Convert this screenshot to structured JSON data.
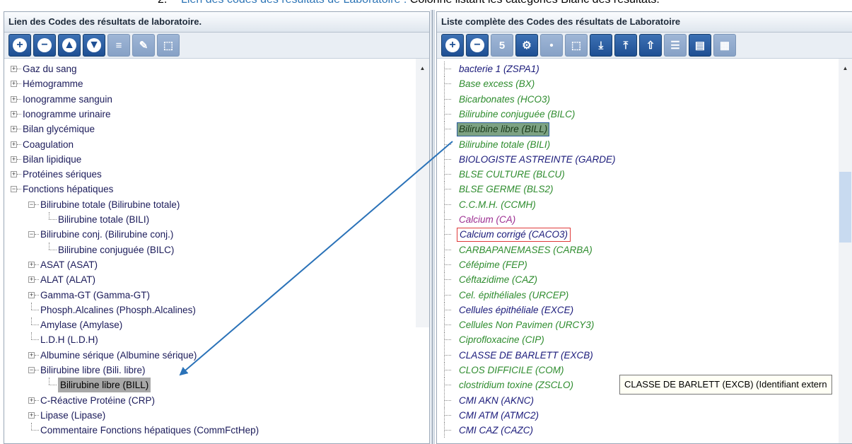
{
  "doc": {
    "number": "2.",
    "link_text": "Lien des codes des résultats de Laboratoire :",
    "rest_text": " Colonne listant les catégories Blanc des résultats."
  },
  "left_panel": {
    "title": "Lien des Codes des résultats de laboratoire.",
    "toolbar": [
      {
        "name": "add",
        "glyph": "+"
      },
      {
        "name": "remove",
        "glyph": "−"
      },
      {
        "name": "move-up",
        "glyph": "▲"
      },
      {
        "name": "move-down",
        "glyph": "▼"
      },
      {
        "name": "sort",
        "glyph": "≡"
      },
      {
        "name": "edit",
        "glyph": "✎"
      },
      {
        "name": "select-all",
        "glyph": "⬚"
      }
    ],
    "tree": [
      {
        "label": "Gaz du sang",
        "level": 0,
        "expander": "+"
      },
      {
        "label": "Hémogramme",
        "level": 0,
        "expander": "+"
      },
      {
        "label": "Ionogramme sanguin",
        "level": 0,
        "expander": "+"
      },
      {
        "label": "Ionogramme urinaire",
        "level": 0,
        "expander": "+"
      },
      {
        "label": "Bilan glycémique",
        "level": 0,
        "expander": "+"
      },
      {
        "label": "Coagulation",
        "level": 0,
        "expander": "+"
      },
      {
        "label": "Bilan lipidique",
        "level": 0,
        "expander": "+"
      },
      {
        "label": "Protéines sériques",
        "level": 0,
        "expander": "+"
      },
      {
        "label": "Fonctions hépatiques",
        "level": 0,
        "expander": "−"
      },
      {
        "label": "Bilirubine totale (Bilirubine totale)",
        "level": 1,
        "expander": "−"
      },
      {
        "label": "Bilirubine totale (BILI)",
        "level": 2,
        "expander": ""
      },
      {
        "label": "Bilirubine conj. (Bilirubine conj.)",
        "level": 1,
        "expander": "−"
      },
      {
        "label": "Bilirubine conjuguée (BILC)",
        "level": 2,
        "expander": ""
      },
      {
        "label": "ASAT (ASAT)",
        "level": 1,
        "expander": "+"
      },
      {
        "label": "ALAT (ALAT)",
        "level": 1,
        "expander": "+"
      },
      {
        "label": "Gamma-GT (Gamma-GT)",
        "level": 1,
        "expander": "+"
      },
      {
        "label": "Phosph.Alcalines (Phosph.Alcalines)",
        "level": 1,
        "expander": ""
      },
      {
        "label": "Amylase (Amylase)",
        "level": 1,
        "expander": ""
      },
      {
        "label": "L.D.H (L.D.H)",
        "level": 1,
        "expander": ""
      },
      {
        "label": "Albumine sérique (Albumine sérique)",
        "level": 1,
        "expander": "+"
      },
      {
        "label": "Bilirubine libre (Bili. libre)",
        "level": 1,
        "expander": "−"
      },
      {
        "label": "Bilirubine libre (BILL)",
        "level": 2,
        "expander": "",
        "selected": true
      },
      {
        "label": "C-Réactive Protéine (CRP)",
        "level": 1,
        "expander": "+"
      },
      {
        "label": "Lipase (Lipase)",
        "level": 1,
        "expander": "+"
      },
      {
        "label": "Commentaire Fonctions hépatiques (CommFctHep)",
        "level": 1,
        "expander": ""
      }
    ],
    "scroll_up": "▲"
  },
  "right_panel": {
    "title": "Liste complète des Codes des résultats de Laboratoire",
    "toolbar": [
      {
        "name": "add",
        "glyph": "+"
      },
      {
        "name": "remove",
        "glyph": "−"
      },
      {
        "name": "number",
        "glyph": "5"
      },
      {
        "name": "globe",
        "glyph": "⚙"
      },
      {
        "name": "pin",
        "glyph": "•"
      },
      {
        "name": "select-all",
        "glyph": "⬚"
      },
      {
        "name": "import",
        "glyph": "⤓"
      },
      {
        "name": "export",
        "glyph": "⤒"
      },
      {
        "name": "upload",
        "glyph": "⇧"
      },
      {
        "name": "list",
        "glyph": "☰"
      },
      {
        "name": "calculator",
        "glyph": "▤"
      },
      {
        "name": "grid",
        "glyph": "▦"
      }
    ],
    "items": [
      {
        "label": "bacterie 1 (ZSPA1)",
        "color": "navy"
      },
      {
        "label": "Base excess (BX)",
        "color": "green"
      },
      {
        "label": "Bicarbonates (HCO3)",
        "color": "green"
      },
      {
        "label": "Bilirubine conjuguée (BILC)",
        "color": "green"
      },
      {
        "label": "Bilirubine libre (BILL)",
        "color": "green",
        "highlight": "selected"
      },
      {
        "label": "Bilirubine totale (BILI)",
        "color": "green"
      },
      {
        "label": "BIOLOGISTE ASTREINTE (GARDE)",
        "color": "navy"
      },
      {
        "label": "BLSE CULTURE (BLCU)",
        "color": "green"
      },
      {
        "label": "BLSE GERME (BLS2)",
        "color": "green"
      },
      {
        "label": "C.C.M.H. (CCMH)",
        "color": "green"
      },
      {
        "label": "Calcium (CA)",
        "color": "purple"
      },
      {
        "label": "Calcium corrigé (CACO3)",
        "color": "navy",
        "highlight": "red"
      },
      {
        "label": "CARBAPANEMASES (CARBA)",
        "color": "green"
      },
      {
        "label": "Céfépime (FEP)",
        "color": "green"
      },
      {
        "label": "Céftazidime (CAZ)",
        "color": "green"
      },
      {
        "label": "Cel. épithéliales (URCEP)",
        "color": "green"
      },
      {
        "label": "Cellules épithéliale (EXCE)",
        "color": "navy"
      },
      {
        "label": "Cellules Non Pavimen (URCY3)",
        "color": "green"
      },
      {
        "label": "Ciprofloxacine (CIP)",
        "color": "green"
      },
      {
        "label": "CLASSE DE BARLETT (EXCB)",
        "color": "navy"
      },
      {
        "label": "CLOS DIFFICILE (COM)",
        "color": "green"
      },
      {
        "label": "clostridium toxine (ZSCLO)",
        "color": "green"
      },
      {
        "label": "CMI AKN (AKNC)",
        "color": "navy"
      },
      {
        "label": "CMI ATM (ATMC2)",
        "color": "navy"
      },
      {
        "label": "CMI CAZ (CAZC)",
        "color": "navy"
      }
    ],
    "scroll_up": "▲",
    "tooltip": "CLASSE DE BARLETT (EXCB) (Identifiant extern"
  },
  "colors": {
    "green": "#2e8c2e",
    "navy": "#1a1a7a",
    "purple": "#9c2d91",
    "arrow": "#2a72b8"
  }
}
